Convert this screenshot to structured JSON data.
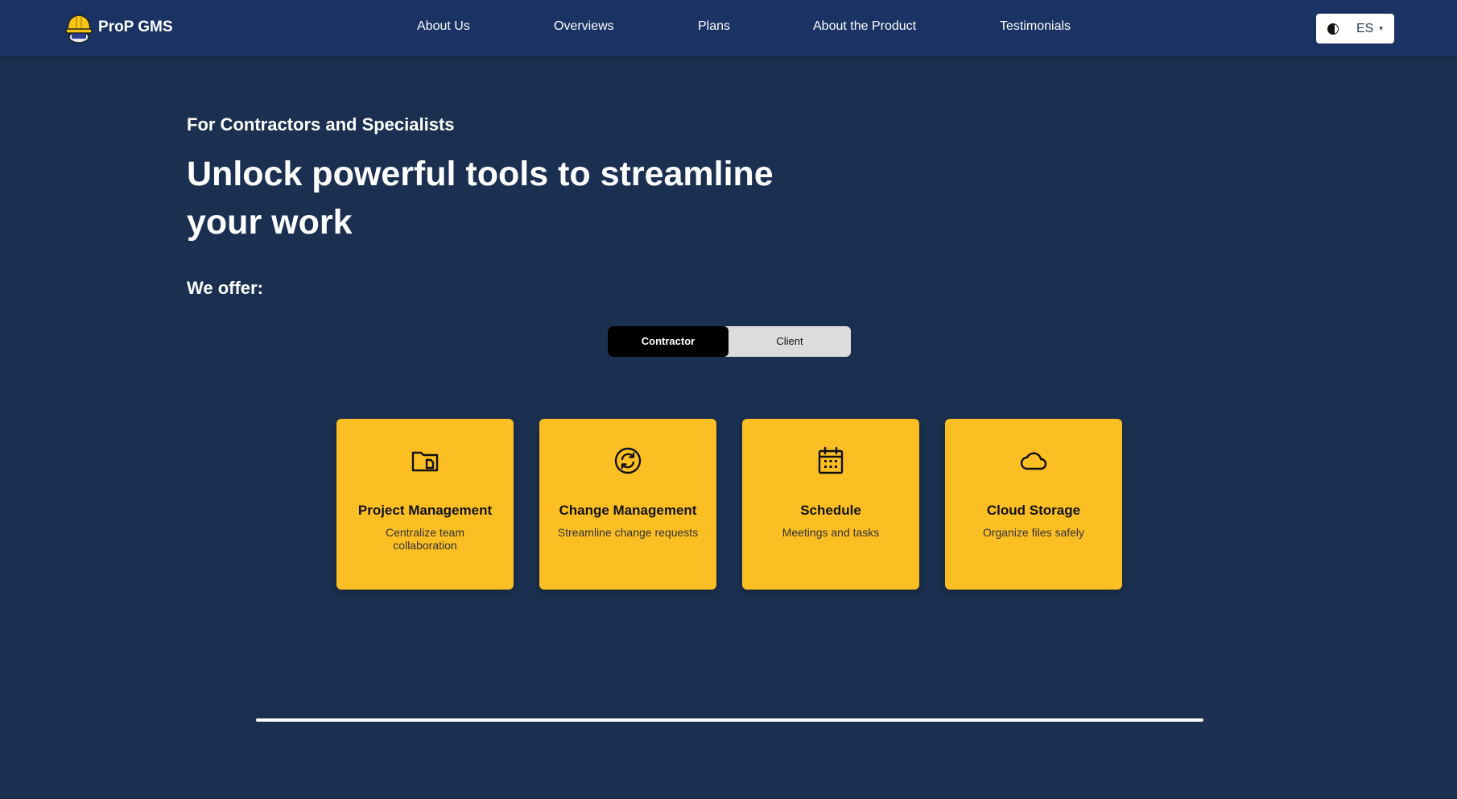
{
  "brand": {
    "name": "ProP GMS",
    "logo_icon": "hardhat-icon"
  },
  "nav": {
    "links": [
      "About Us",
      "Overviews",
      "Plans",
      "About the Product",
      "Testimonials"
    ]
  },
  "language": {
    "code": "ES",
    "flag_icon": "flag-icon",
    "caret": "▾"
  },
  "hero": {
    "eyebrow": "For Contractors and Specialists",
    "headline": "Unlock powerful tools to streamline your work",
    "offer_label": "We offer:"
  },
  "toggle": {
    "options": [
      "Contractor",
      "Client"
    ],
    "selected": "Contractor"
  },
  "features": [
    {
      "icon": "folder-icon",
      "title": "Project Management",
      "description": "Centralize team collaboration"
    },
    {
      "icon": "refresh-icon",
      "title": "Change Management",
      "description": "Streamline change requests"
    },
    {
      "icon": "calendar-icon",
      "title": "Schedule",
      "description": "Meetings and tasks"
    },
    {
      "icon": "cloud-icon",
      "title": "Cloud Storage",
      "description": "Organize files safely"
    }
  ],
  "colors": {
    "background": "#1b3050",
    "header": "#1a3364",
    "card": "#fbbf24",
    "toggle_active": "#000000",
    "toggle_inactive": "#dcdcdc"
  }
}
